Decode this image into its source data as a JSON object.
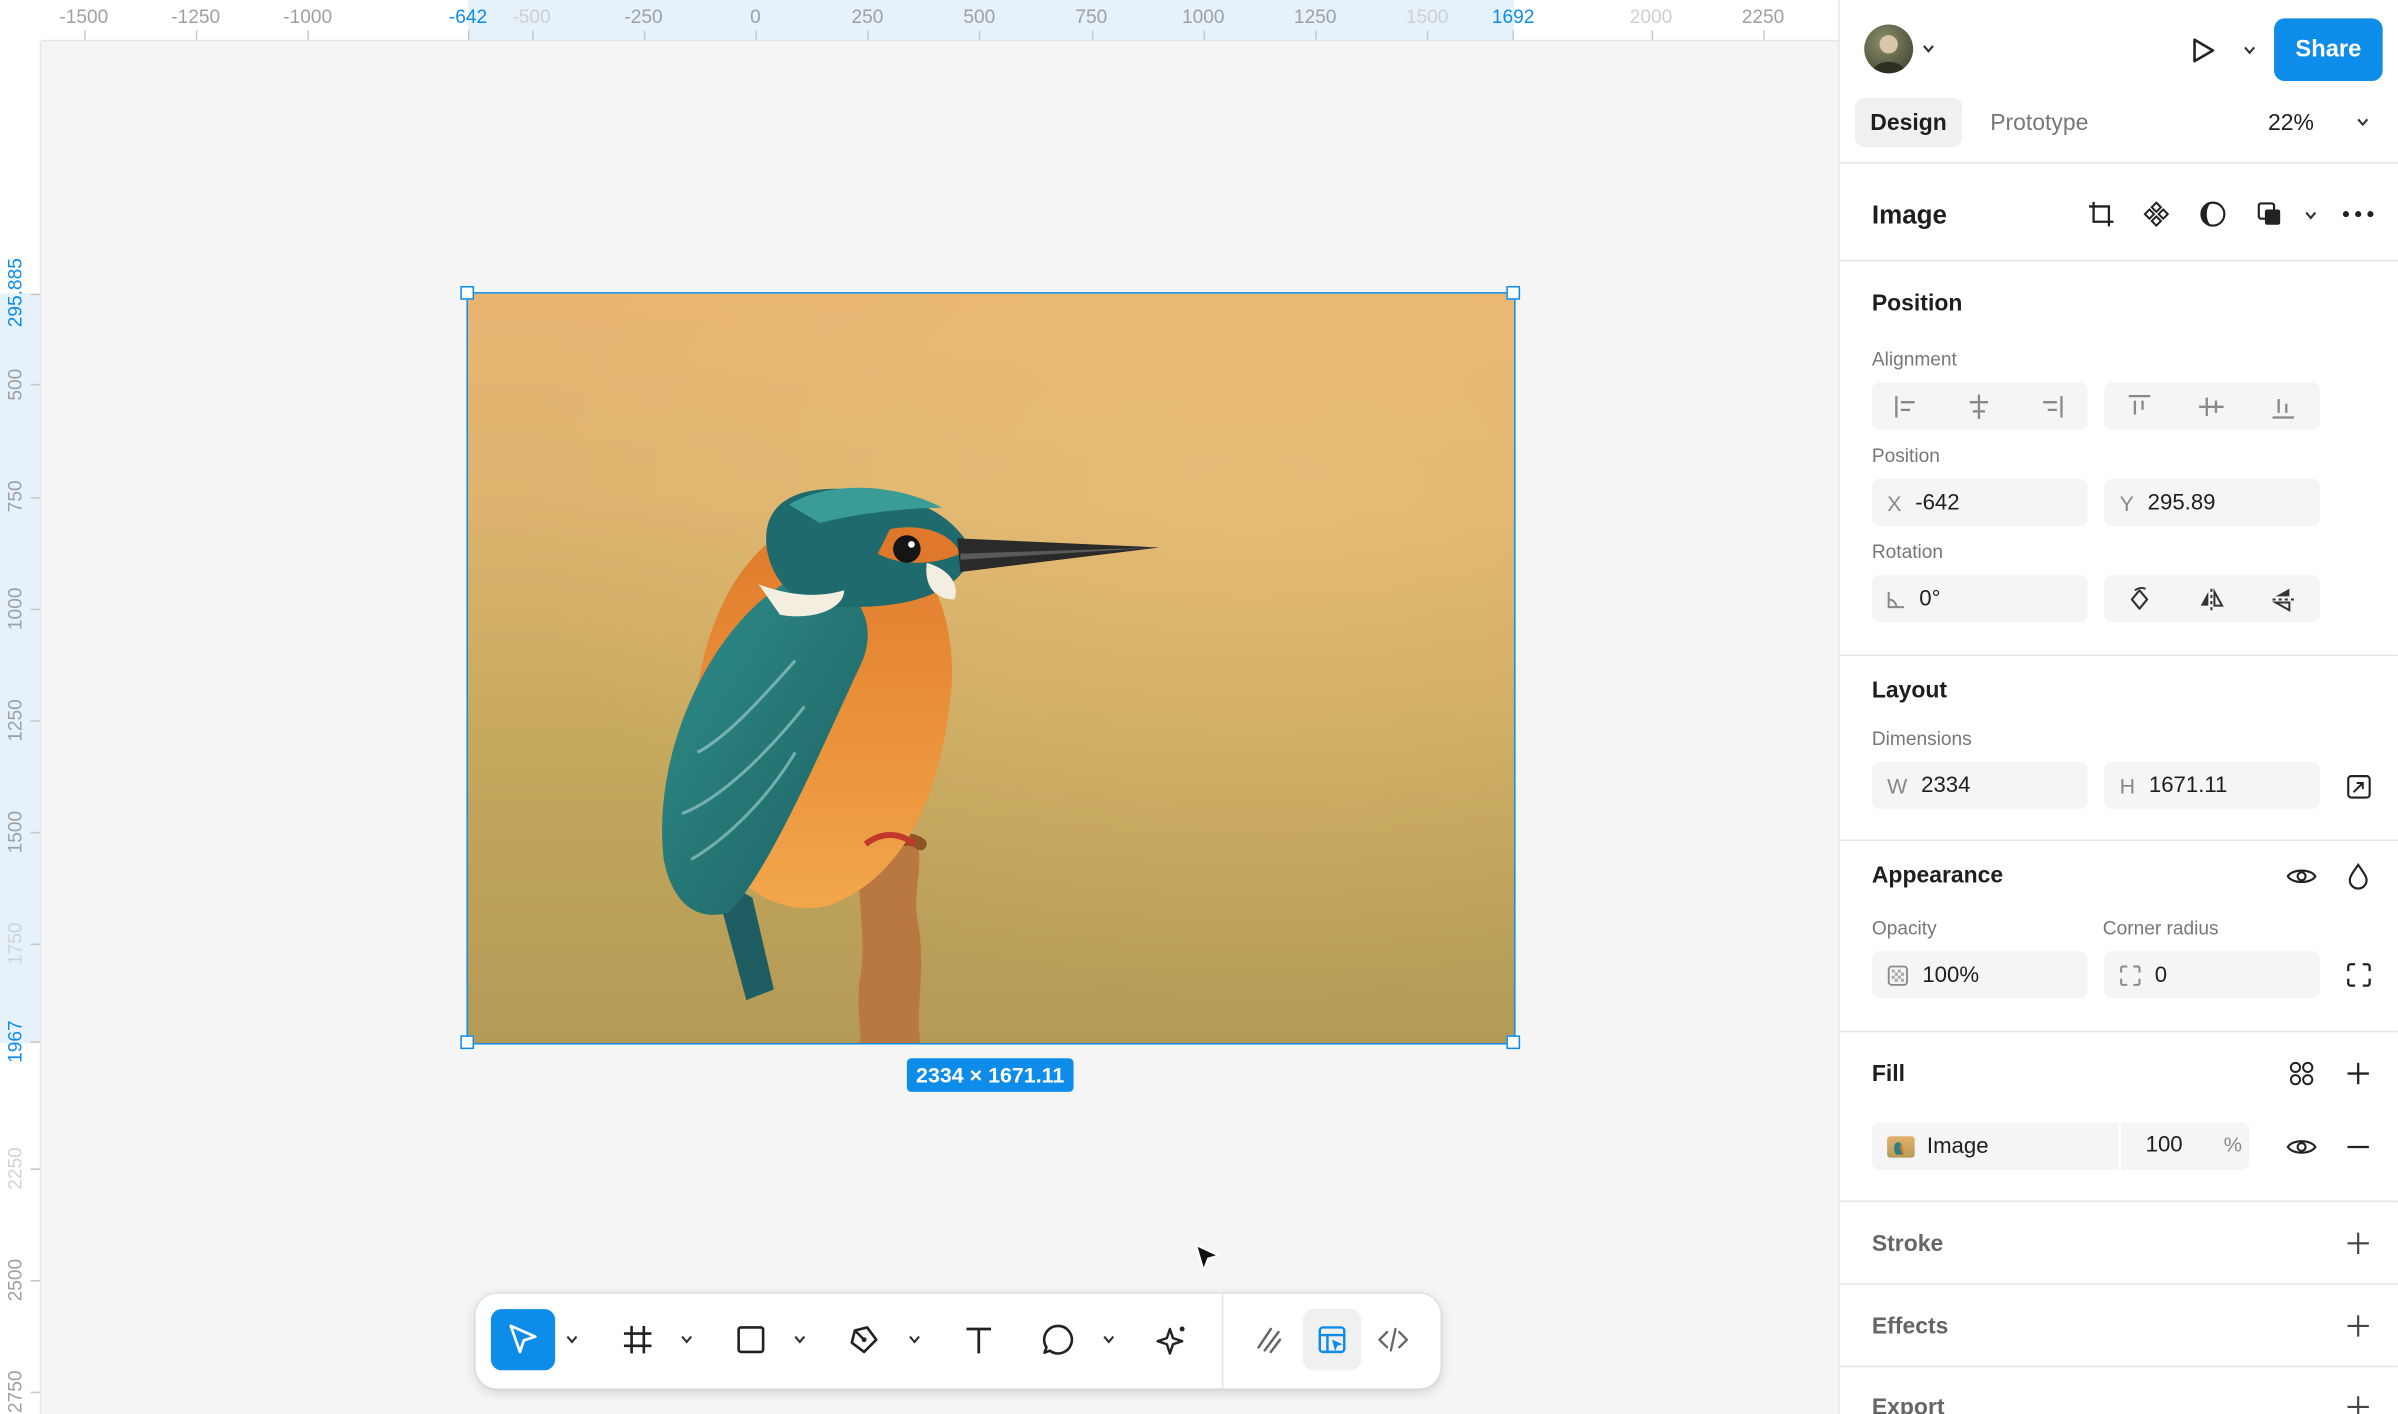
{
  "rulers": {
    "top_labels": [
      {
        "text": "-1500",
        "state": "normal"
      },
      {
        "text": "-1250",
        "state": "normal"
      },
      {
        "text": "-1000",
        "state": "normal"
      },
      {
        "text": "-642",
        "state": "selected"
      },
      {
        "text": "-500",
        "state": "faint"
      },
      {
        "text": "-250",
        "state": "normal"
      },
      {
        "text": "0",
        "state": "normal"
      },
      {
        "text": "250",
        "state": "normal"
      },
      {
        "text": "500",
        "state": "normal"
      },
      {
        "text": "750",
        "state": "normal"
      },
      {
        "text": "1000",
        "state": "normal"
      },
      {
        "text": "1250",
        "state": "normal"
      },
      {
        "text": "1500",
        "state": "faint"
      },
      {
        "text": "1692",
        "state": "selected"
      },
      {
        "text": "2000",
        "state": "faint"
      },
      {
        "text": "2250",
        "state": "normal"
      }
    ],
    "left_labels": [
      {
        "text": "295.885",
        "state": "selected"
      },
      {
        "text": "500",
        "state": "normal"
      },
      {
        "text": "750",
        "state": "normal"
      },
      {
        "text": "1000",
        "state": "normal"
      },
      {
        "text": "1250",
        "state": "normal"
      },
      {
        "text": "1500",
        "state": "normal"
      },
      {
        "text": "1750",
        "state": "faint"
      },
      {
        "text": "1967",
        "state": "selected"
      },
      {
        "text": "2250",
        "state": "faint"
      },
      {
        "text": "2500",
        "state": "normal"
      },
      {
        "text": "2750",
        "state": "normal"
      }
    ]
  },
  "canvas": {
    "selection_size_badge": "2334 × 1671.11",
    "image_subject": "kingfisher-on-branch"
  },
  "toolbar": {
    "tools": [
      "move-tool",
      "frame-tool",
      "rectangle-tool",
      "pen-tool",
      "text-tool",
      "comment-tool",
      "ai-actions-tool"
    ],
    "modes": [
      "draw-mode",
      "design-mode",
      "dev-mode"
    ],
    "active_tool": "move-tool",
    "active_mode": "design-mode"
  },
  "header": {
    "share_label": "Share",
    "tabs": [
      "Design",
      "Prototype"
    ],
    "active_tab": "Design",
    "zoom": "22%"
  },
  "layer": {
    "title": "Image"
  },
  "position": {
    "heading": "Position",
    "alignment_label": "Alignment",
    "position_label": "Position",
    "x_prefix": "X",
    "x_value": "-642",
    "y_prefix": "Y",
    "y_value": "295.89",
    "rotation_label": "Rotation",
    "rotation_value": "0°"
  },
  "layout": {
    "heading": "Layout",
    "dimensions_label": "Dimensions",
    "w_prefix": "W",
    "w_value": "2334",
    "h_prefix": "H",
    "h_value": "1671.11"
  },
  "appearance": {
    "heading": "Appearance",
    "opacity_label": "Opacity",
    "opacity_value": "100%",
    "radius_label": "Corner radius",
    "radius_value": "0"
  },
  "fill": {
    "heading": "Fill",
    "type": "Image",
    "opacity": "100",
    "unit": "%"
  },
  "stroke": {
    "heading": "Stroke"
  },
  "effects": {
    "heading": "Effects"
  },
  "export": {
    "heading": "Export"
  },
  "colors": {
    "accent": "#0d8ce9",
    "panel_bg": "#ffffff",
    "canvas_bg": "#f5f5f5",
    "field_bg": "#f5f5f5"
  }
}
